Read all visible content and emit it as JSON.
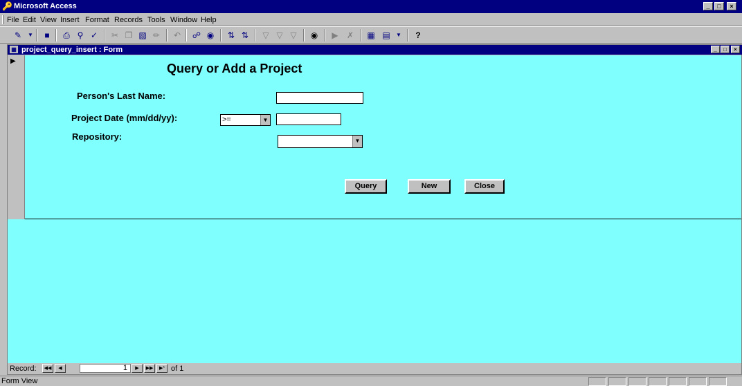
{
  "app": {
    "title": "Microsoft Access",
    "window_buttons": [
      "_",
      "□",
      "×"
    ]
  },
  "menu": {
    "items": [
      {
        "label": "File"
      },
      {
        "label": "Edit"
      },
      {
        "label": "View"
      },
      {
        "label": "Insert"
      },
      {
        "label": "Format"
      },
      {
        "label": "Records"
      },
      {
        "label": "Tools"
      },
      {
        "label": "Window"
      },
      {
        "label": "Help"
      }
    ]
  },
  "toolbar": {
    "icons": [
      "view-icon",
      "save-icon",
      "print-icon",
      "print-preview-icon",
      "spelling-icon",
      "cut-icon",
      "copy-icon",
      "paste-icon",
      "format-painter-icon",
      "undo-icon",
      "insert-hyperlink-icon",
      "web-toolbar-icon",
      "sort-ascending-icon",
      "sort-descending-icon",
      "filter-by-selection-icon",
      "filter-by-form-icon",
      "apply-filter-icon",
      "find-icon",
      "new-record-icon",
      "delete-record-icon",
      "database-window-icon",
      "new-object-icon",
      "help-icon"
    ]
  },
  "form": {
    "window_title": "project_query_insert : Form",
    "heading": "Query or Add a Project",
    "last_name_label": "Person's Last Name:",
    "last_name_value": "",
    "project_date_label": "Project Date (mm/dd/yy):",
    "date_operator": ">=",
    "date_value": "",
    "repository_label": "Repository:",
    "repository_value": "",
    "buttons": {
      "query": "Query",
      "new": "New",
      "close": "Close"
    }
  },
  "navigation": {
    "record_label": "Record:",
    "current_record": "1",
    "total_text": "of 1"
  },
  "status": {
    "text": "Form View"
  },
  "colors": {
    "form_background": "#80ffff",
    "title_bar": "#000080",
    "chrome": "#c0c0c0"
  }
}
